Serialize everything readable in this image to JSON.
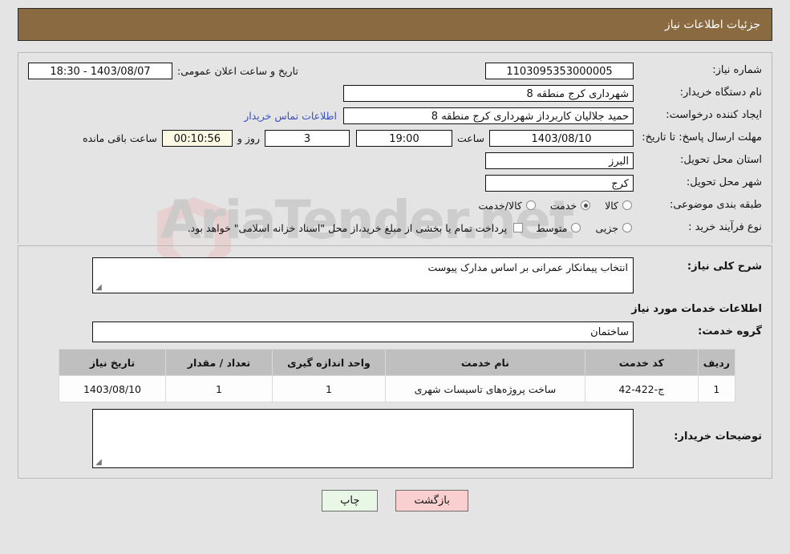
{
  "header": {
    "title": "جزئیات اطلاعات نیاز"
  },
  "top_form": {
    "need_number": {
      "label": "شماره نیاز:",
      "value": "1103095353000005"
    },
    "public_announce": {
      "label": "تاریخ و ساعت اعلان عمومی:",
      "value": "1403/08/07 - 18:30"
    },
    "buyer_org": {
      "label": "نام دستگاه خریدار:",
      "value": "شهرداری کرج منطقه 8"
    },
    "request_creator": {
      "label": "ایجاد کننده درخواست:",
      "value": "حمید جلالیان کاربرداز شهرداری کرج منطقه 8"
    },
    "buyer_contact_link": "اطلاعات تماس خریدار",
    "deadline": {
      "label": "مهلت ارسال پاسخ: تا تاریخ:",
      "date": "1403/08/10",
      "time_label": "ساعت",
      "time": "19:00",
      "days": "3",
      "days_label": "روز و",
      "countdown": "00:10:56",
      "countdown_label": "ساعت باقی مانده"
    },
    "delivery_province": {
      "label": "استان محل تحویل:",
      "value": "البرز"
    },
    "delivery_city": {
      "label": "شهر محل تحویل:",
      "value": "کرج"
    },
    "category": {
      "label": "طبقه بندی موضوعی:",
      "options": [
        {
          "label": "کالا",
          "selected": false
        },
        {
          "label": "خدمت",
          "selected": true
        },
        {
          "label": "کالا/خدمت",
          "selected": false
        }
      ]
    },
    "purchase_process": {
      "label": "نوع فرآیند خرید :",
      "options": [
        {
          "label": "جزیی",
          "selected": false
        },
        {
          "label": "متوسط",
          "selected": false
        }
      ],
      "checkbox_note": "پرداخت تمام یا بخشی از مبلغ خرید،از محل \"اسناد خزانه اسلامی\" خواهد بود.",
      "checkbox_checked": false
    }
  },
  "details": {
    "general_desc_label": "شرح کلی نیاز:",
    "general_desc_value": "انتخاب پیمانکار عمرانی بر اساس مدارک پیوست",
    "services_section_title": "اطلاعات خدمات مورد نیاز",
    "service_group_label": "گروه خدمت:",
    "service_group_value": "ساختمان"
  },
  "items_table": {
    "columns": [
      "ردیف",
      "کد خدمت",
      "نام خدمت",
      "واحد اندازه گیری",
      "تعداد / مقدار",
      "تاریخ نیاز"
    ],
    "rows": [
      {
        "radif": "1",
        "code": "ج-422-42",
        "name": "ساخت پروژه‌های تاسیسات شهری",
        "unit": "1",
        "qty": "1",
        "date": "1403/08/10"
      }
    ]
  },
  "buyer_comments": {
    "label": "توضیحات خریدار:",
    "value": ""
  },
  "buttons": {
    "print": "چاپ",
    "back": "بازگشت"
  },
  "watermark": {
    "text": "AriaTender.net"
  },
  "colors": {
    "header_bar": "#8a6a41",
    "page_bg": "#e4e4e4",
    "link": "#3b4fbf",
    "print_btn": "#e9f7e6",
    "back_btn": "#f9cfcf",
    "countdown_bg": "#fbf8e3",
    "table_header": "#bfbfbf"
  }
}
